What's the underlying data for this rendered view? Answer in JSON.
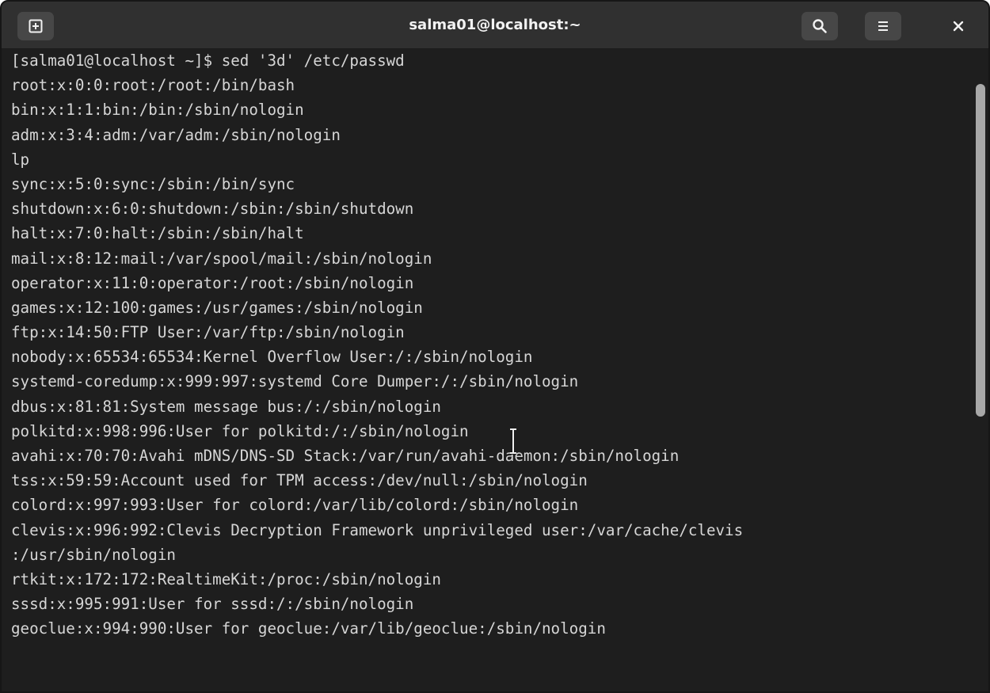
{
  "window": {
    "title": "salma01@localhost:~"
  },
  "icons": {
    "new_tab": "new-tab-icon",
    "search": "search-icon",
    "menu": "hamburger-menu-icon",
    "close": "close-icon"
  },
  "colors": {
    "terminal_bg": "#1e1e1e",
    "titlebar_bg": "#303030",
    "button_bg": "#474747",
    "text": "#d6d6d6"
  },
  "terminal": {
    "lines": [
      "[salma01@localhost ~]$ sed '3d' /etc/passwd",
      "root:x:0:0:root:/root:/bin/bash",
      "bin:x:1:1:bin:/bin:/sbin/nologin",
      "adm:x:3:4:adm:/var/adm:/sbin/nologin",
      "lp",
      "sync:x:5:0:sync:/sbin:/bin/sync",
      "shutdown:x:6:0:shutdown:/sbin:/sbin/shutdown",
      "halt:x:7:0:halt:/sbin:/sbin/halt",
      "mail:x:8:12:mail:/var/spool/mail:/sbin/nologin",
      "operator:x:11:0:operator:/root:/sbin/nologin",
      "games:x:12:100:games:/usr/games:/sbin/nologin",
      "ftp:x:14:50:FTP User:/var/ftp:/sbin/nologin",
      "nobody:x:65534:65534:Kernel Overflow User:/:/sbin/nologin",
      "systemd-coredump:x:999:997:systemd Core Dumper:/:/sbin/nologin",
      "dbus:x:81:81:System message bus:/:/sbin/nologin",
      "polkitd:x:998:996:User for polkitd:/:/sbin/nologin",
      "avahi:x:70:70:Avahi mDNS/DNS-SD Stack:/var/run/avahi-daemon:/sbin/nologin",
      "tss:x:59:59:Account used for TPM access:/dev/null:/sbin/nologin",
      "colord:x:997:993:User for colord:/var/lib/colord:/sbin/nologin",
      "clevis:x:996:992:Clevis Decryption Framework unprivileged user:/var/cache/clevis",
      ":/usr/sbin/nologin",
      "rtkit:x:172:172:RealtimeKit:/proc:/sbin/nologin",
      "sssd:x:995:991:User for sssd:/:/sbin/nologin",
      "geoclue:x:994:990:User for geoclue:/var/lib/geoclue:/sbin/nologin"
    ]
  }
}
